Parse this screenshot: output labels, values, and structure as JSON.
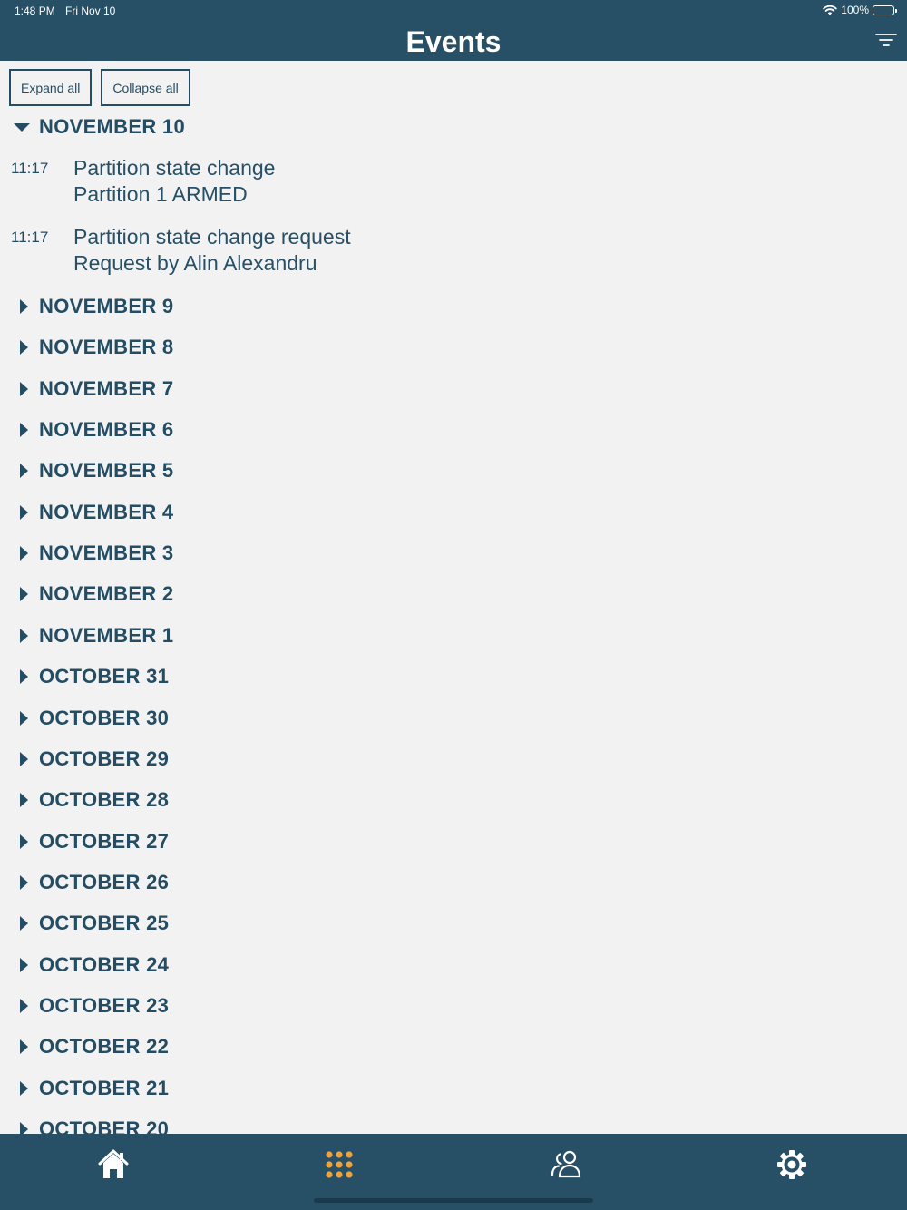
{
  "status_bar": {
    "time": "1:48 PM",
    "date": "Fri Nov 10",
    "battery": "100%"
  },
  "header": {
    "title": "Events",
    "filter_icon": "filter-lines-icon"
  },
  "toolbar": {
    "expand_label": "Expand all",
    "collapse_label": "Collapse all"
  },
  "expanded_day": {
    "label": "NOVEMBER 10",
    "events": [
      {
        "time": "11:17",
        "title": "Partition state change",
        "detail": "Partition 1 ARMED"
      },
      {
        "time": "11:17",
        "title": "Partition state change request",
        "detail": "Request by Alin Alexandru"
      }
    ]
  },
  "collapsed_days": [
    "NOVEMBER 9",
    "NOVEMBER 8",
    "NOVEMBER 7",
    "NOVEMBER 6",
    "NOVEMBER 5",
    "NOVEMBER 4",
    "NOVEMBER 3",
    "NOVEMBER 2",
    "NOVEMBER 1",
    "OCTOBER 31",
    "OCTOBER 30",
    "OCTOBER 29",
    "OCTOBER 28",
    "OCTOBER 27",
    "OCTOBER 26",
    "OCTOBER 25",
    "OCTOBER 24",
    "OCTOBER 23",
    "OCTOBER 22",
    "OCTOBER 21",
    "OCTOBER 20"
  ],
  "tabbar": {
    "tabs": [
      {
        "icon": "home-icon",
        "active": false
      },
      {
        "icon": "keypad-icon",
        "active": true
      },
      {
        "icon": "users-icon",
        "active": false
      },
      {
        "icon": "gear-icon",
        "active": false
      }
    ]
  },
  "colors": {
    "header_bg": "#275066",
    "page_bg": "#f2f2f3",
    "text": "#244d63",
    "active_tab": "#f0a23c",
    "inactive_tab": "#ffffff"
  }
}
